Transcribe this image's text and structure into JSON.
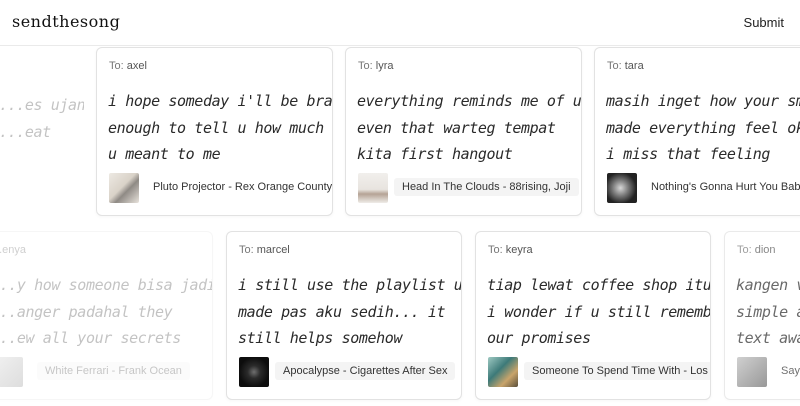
{
  "header": {
    "brand": "sendthesong",
    "submit_label": "Submit"
  },
  "to_prefix": "To:",
  "cards": [
    {
      "to": "",
      "message": [
        "...es ujan",
        "...eat"
      ],
      "song": "",
      "faded": true
    },
    {
      "to": "axel",
      "message": [
        "i hope someday i'll be brave",
        "enough to tell u how much",
        "u meant to me"
      ],
      "song": "Pluto Projector - Rex Orange County",
      "thumb": "pluto"
    },
    {
      "to": "lyra",
      "message": [
        "everything reminds me of u,",
        "even that warteg tempat",
        "kita first hangout"
      ],
      "song": "Head In The Clouds - 88rising, Joji",
      "thumb": "clouds"
    },
    {
      "to": "tara",
      "message": [
        "masih inget how your smile",
        "made everything feel okay",
        "i miss that feeling"
      ],
      "song": "Nothing's Gonna Hurt You Baby -",
      "thumb": "nothing"
    },
    {
      "to": "...enya",
      "message": [
        "...y how someone bisa jadi",
        "...anger padahal they",
        "...ew all your secrets"
      ],
      "song": "White Ferrari - Frank Ocean",
      "thumb": "white",
      "faded": true
    },
    {
      "to": "marcel",
      "message": [
        "i still use the playlist u",
        "made pas aku sedih... it",
        "still helps somehow"
      ],
      "song": "Apocalypse - Cigarettes After Sex",
      "thumb": "apoc"
    },
    {
      "to": "keyra",
      "message": [
        "tiap lewat coffee shop itu",
        "i wonder if u still remember",
        "our promises"
      ],
      "song": "Someone To Spend Time With - Los",
      "thumb": "someone"
    },
    {
      "to": "dion",
      "message": [
        "kangen v...",
        "simple a...",
        "text awa..."
      ],
      "song": "Say",
      "thumb": "say"
    }
  ]
}
